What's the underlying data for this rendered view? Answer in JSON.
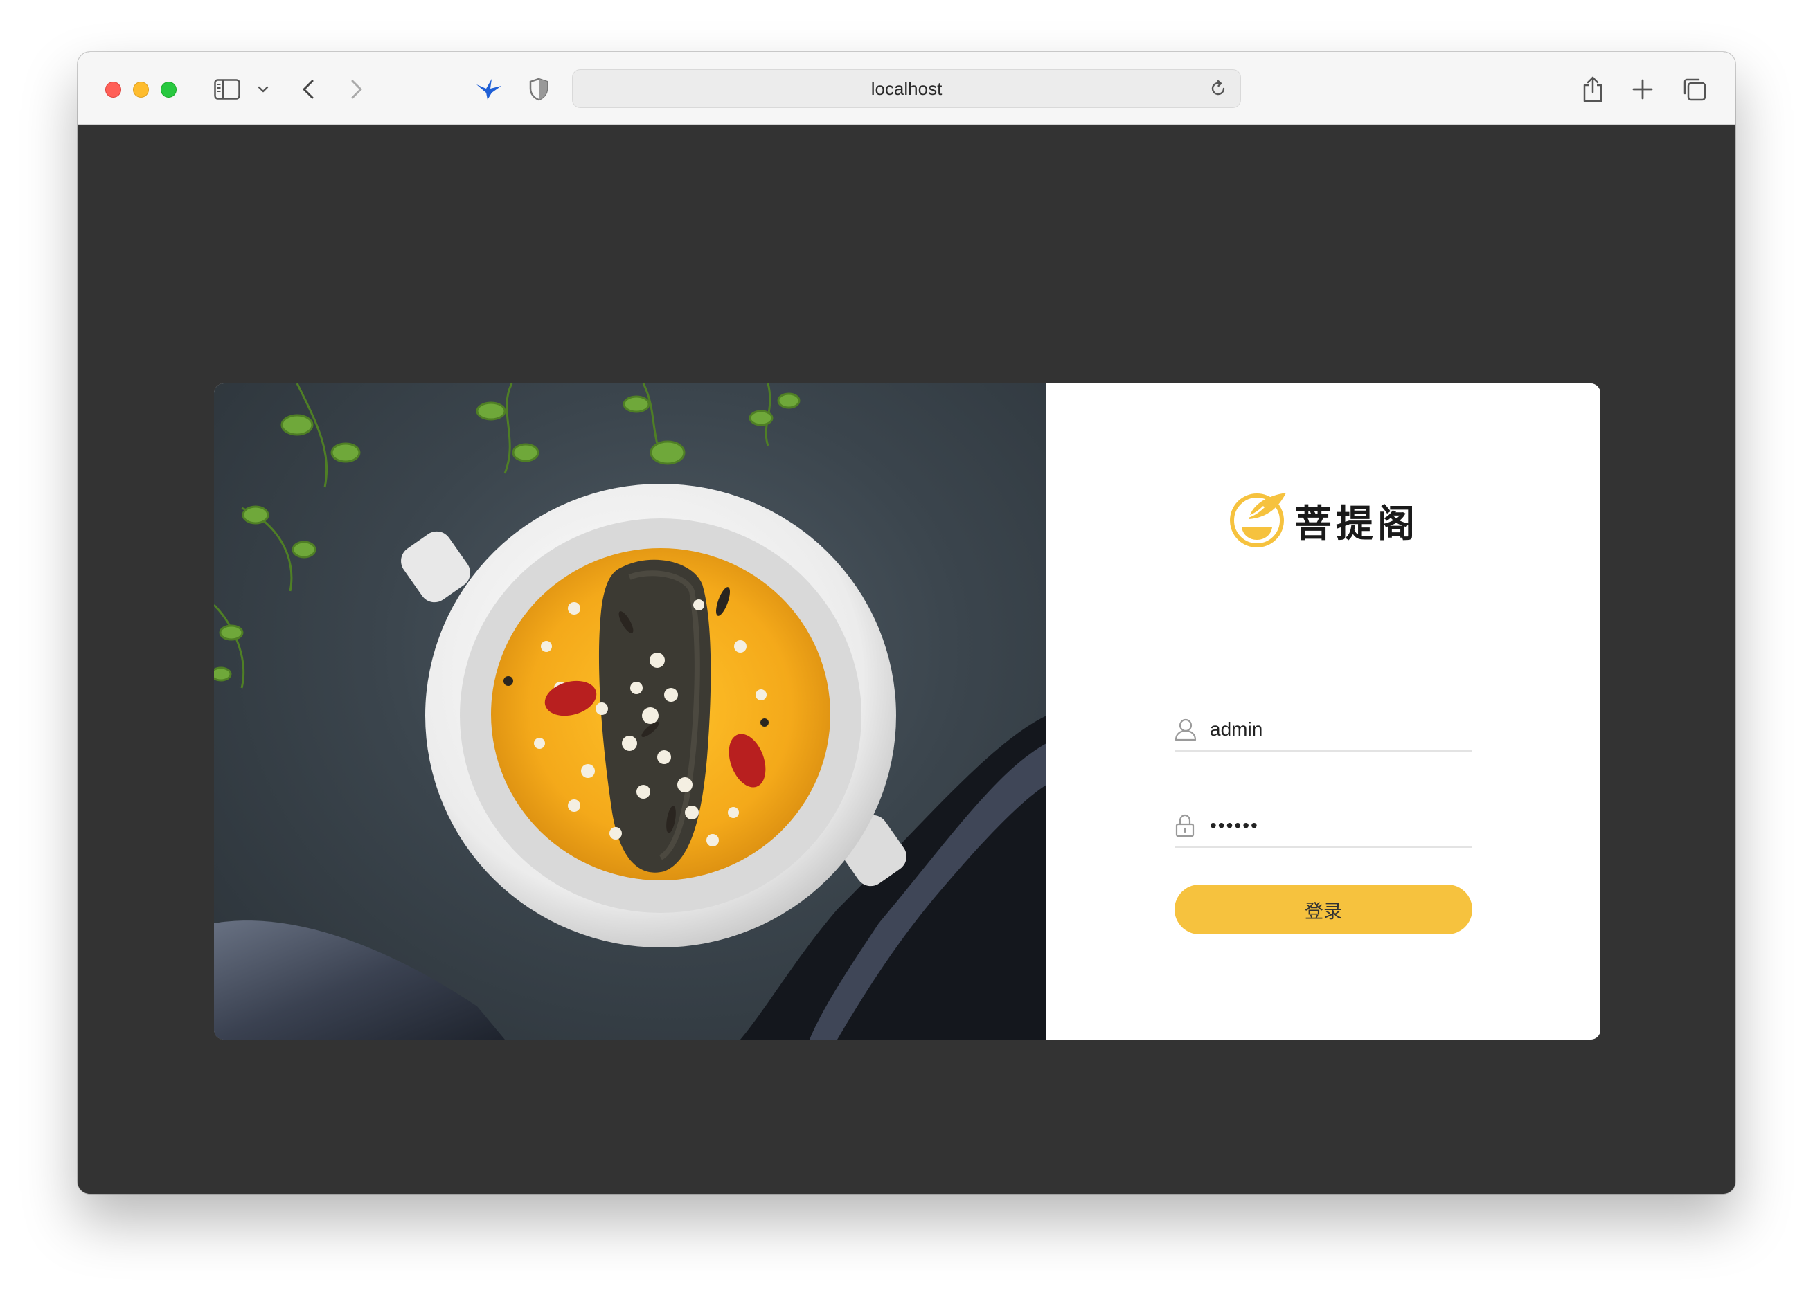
{
  "browser": {
    "address": "localhost",
    "icons": {
      "sidebar": "sidebar-icon",
      "sidebar_menu": "chevron-down-icon",
      "back": "chevron-left-icon",
      "forward": "chevron-right-icon",
      "extension_bird": "bird-extension-icon",
      "privacy": "shield-icon",
      "reload": "reload-icon",
      "share": "share-icon",
      "new_tab": "plus-icon",
      "tab_overview": "tabs-overview-icon"
    }
  },
  "login": {
    "brand_name": "菩提阁",
    "username_value": "admin",
    "password_value": "••••••",
    "submit_label": "登录",
    "icons": {
      "logo": "leaf-bowl-logo",
      "user": "user-icon",
      "lock": "lock-icon"
    }
  },
  "colors": {
    "accent": "#f6c23e",
    "page_background": "#333333",
    "card_background": "#ffffff"
  },
  "photo": {
    "description_icon": "food-photo"
  }
}
